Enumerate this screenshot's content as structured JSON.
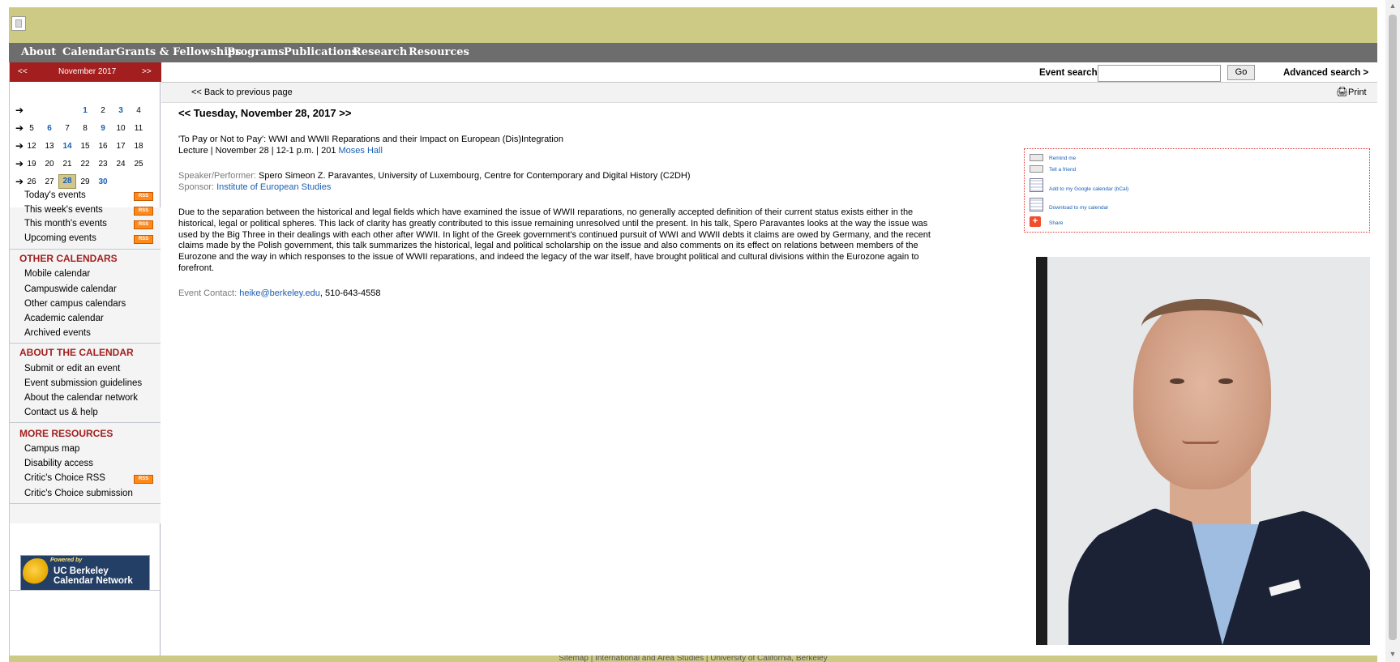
{
  "nav": {
    "items": [
      "About",
      "Calendar",
      "Grants & Fellowships",
      "Programs",
      "Publications",
      "Research",
      "Resources"
    ]
  },
  "calendar": {
    "prev_label": "<<",
    "next_label": ">>",
    "month_label": "November 2017",
    "weeks": [
      [
        "",
        "",
        "",
        "1",
        "2",
        "3",
        "4"
      ],
      [
        "5",
        "6",
        "7",
        "8",
        "9",
        "10",
        "11"
      ],
      [
        "12",
        "13",
        "14",
        "15",
        "16",
        "17",
        "18"
      ],
      [
        "19",
        "20",
        "21",
        "22",
        "23",
        "24",
        "25"
      ],
      [
        "26",
        "27",
        "28",
        "29",
        "30",
        "",
        ""
      ]
    ],
    "linked_days": [
      "1",
      "3",
      "6",
      "9",
      "14",
      "28",
      "30"
    ],
    "today": "28"
  },
  "sidebar": {
    "quick_links": [
      "Today's events",
      "This week's events",
      "This month's events",
      "Upcoming events"
    ],
    "rss_label": "RSS",
    "other_calendars": {
      "heading": "OTHER CALENDARS",
      "items": [
        "Mobile calendar",
        "Campuswide calendar",
        "Other campus calendars",
        "Academic calendar",
        "Archived events"
      ]
    },
    "about": {
      "heading": "ABOUT THE CALENDAR",
      "items": [
        "Submit or edit an event",
        "Event submission guidelines",
        "About the calendar network",
        "Contact us & help"
      ]
    },
    "more": {
      "heading": "MORE RESOURCES",
      "items": [
        "Campus map",
        "Disability access",
        "Critic's Choice RSS",
        "Critic's Choice submission"
      ]
    },
    "powered": {
      "line1": "Powered by",
      "line2": "UC Berkeley",
      "line3": "Calendar Network"
    }
  },
  "search": {
    "label": "Event search",
    "value": "",
    "go_label": "Go",
    "advanced_label": "Advanced search >"
  },
  "back": {
    "label": "<< Back to previous page",
    "print_label": "Print"
  },
  "event": {
    "date_heading": "<< Tuesday, November 28, 2017 >>",
    "title": "'To Pay or Not to Pay': WWI and WWII Reparations and their Impact on European (Dis)Integration",
    "meta_prefix": "Lecture | November 28 | 12-1 p.m. | 201 ",
    "location_link": "Moses Hall",
    "speaker_label": "Speaker/Performer:",
    "speaker": "Spero Simeon Z. Paravantes, University of Luxembourg, Centre for Contemporary and Digital History (C2DH)",
    "sponsor_label": "Sponsor:",
    "sponsor": "Institute of European Studies",
    "description_lines": [
      "Due to the separation between the historical and legal fields which have examined the issue of WWII reparations, no generally accepted definition of their current status exists either in the",
      "historical, legal or political spheres. This lack of clarity has greatly contributed to this issue remaining unresolved until the present. In his talk, Spero Paravantes looks at the way the issue was",
      "used by the Big Three in their dealings with each other after WWII. In light of the Greek government's continued pursuit of WWI and WWII debts it claims are owed by Germany, and the recent",
      "claims made by the Polish government, this talk summarizes the historical, legal and political scholarship on the issue and also comments on its effect on relations between members of the",
      "Eurozone and the way in which responses to the issue of WWII reparations, and indeed the legacy of the war itself, have brought political and cultural divisions within the Eurozone again to",
      "forefront."
    ],
    "contact_label": "Event Contact:",
    "contact_email": "heike@berkeley.edu",
    "contact_phone": ", 510-643-4558"
  },
  "actions": {
    "remind": "Remind me",
    "tell": "Tell a friend",
    "google": "Add to my Google calendar (bCal)",
    "download": "Download to my calendar",
    "share": "Share"
  },
  "footer": {
    "links": [
      "Sitemap",
      "International and Area Studies",
      "University of California, Berkeley"
    ],
    "separator": "|"
  },
  "colors": {
    "banner": "#cdca85",
    "nav": "#6d6d6d",
    "accent_red": "#a31f1f",
    "link_blue": "#1a5fb4"
  }
}
